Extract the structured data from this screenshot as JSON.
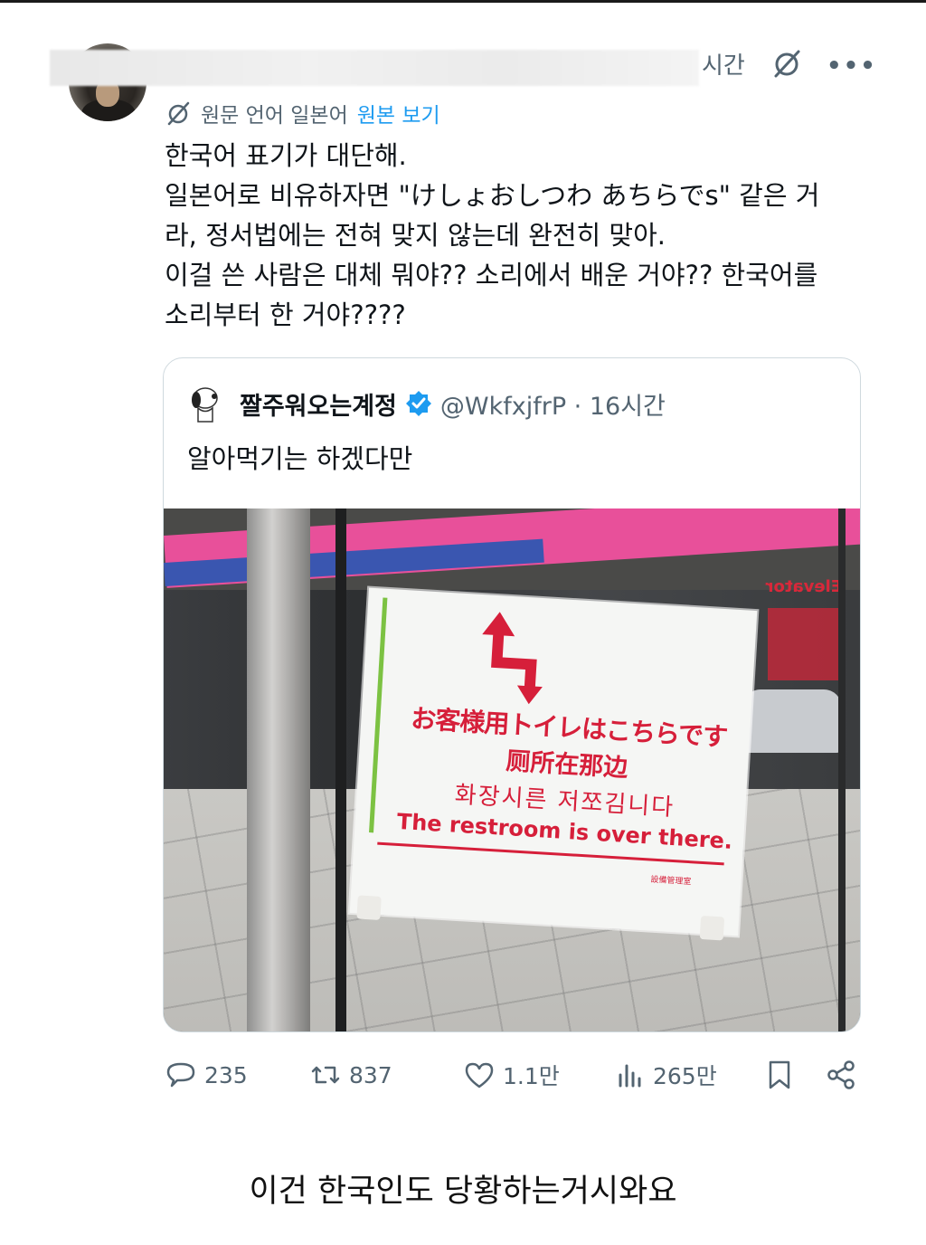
{
  "post": {
    "time": "시간",
    "translate_label": "원문 언어 일본어",
    "view_original": "원본 보기",
    "text_lines": [
      "한국어 표기가 대단해.",
      "일본어로 비유하자면 \"けしょおしつわ あちらでs\" 같은 거",
      "라, 정서법에는 전혀 맞지 않는데 완전히 맞아.",
      "이걸 쓴 사람은 대체 뭐야?? 소리에서 배운 거야?? 한국어를",
      "소리부터 한 거야????"
    ]
  },
  "quoted": {
    "name": "짤주워오는계정",
    "handle": "@WkfxjfrP · 16시간",
    "text": "알아먹기는 하겠다만",
    "sign": {
      "line_jp": "お客様用トイレはこちらです",
      "line_cn": "厕所在那边",
      "line_kr": "화장시른 저쪼김니다",
      "line_en": "The restroom is over there.",
      "footer": "設備管理室",
      "elevator": "Elevator"
    }
  },
  "actions": {
    "replies": "235",
    "reposts": "837",
    "likes": "1.1만",
    "views": "265만"
  },
  "caption": "이건 한국인도 당황하는거시와요",
  "colors": {
    "accent": "#1d9bf0",
    "secondary_text": "#536471",
    "sign_red": "#d61f3a"
  }
}
